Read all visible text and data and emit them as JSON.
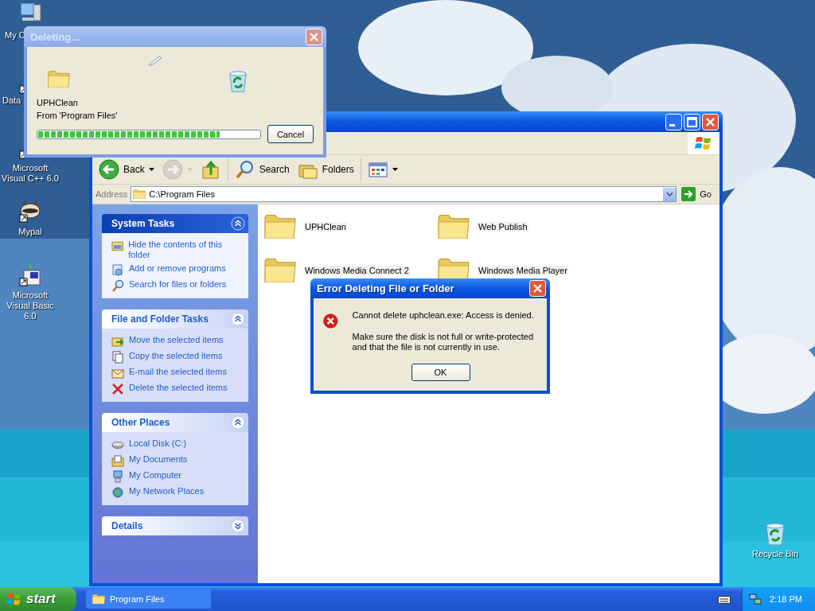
{
  "desktop_icons": [
    {
      "label": "My C",
      "kind": "computer"
    },
    {
      "label": "Data",
      "kind": "shortcut"
    },
    {
      "label": "Microsoft Visual C++ 6.0",
      "kind": "vc"
    },
    {
      "label": "Mypal",
      "kind": "raccoon"
    },
    {
      "label": "Microsoft Visual Basic 6.0",
      "kind": "vb"
    },
    {
      "label": "Recycle Bin",
      "kind": "bin"
    }
  ],
  "explorer": {
    "toolbar": [
      {
        "kind": "back",
        "label": "Back",
        "disabled": false
      },
      {
        "kind": "forward",
        "disabled": true
      },
      {
        "kind": "up",
        "disabled": false
      },
      {
        "kind": "search",
        "label": "Search",
        "disabled": false
      },
      {
        "kind": "folders",
        "label": "Folders",
        "disabled": false
      },
      {
        "kind": "views",
        "disabled": false
      }
    ],
    "address": {
      "label": "Address",
      "value": "C:\\Program Files",
      "go": "Go"
    },
    "panels": [
      {
        "title": "System Tasks",
        "highlighted": true,
        "expanded": true,
        "items": [
          {
            "kind": "hide",
            "label": "Hide the contents of this folder"
          },
          {
            "kind": "programs",
            "label": "Add or remove programs"
          },
          {
            "kind": "search",
            "label": "Search for files or folders"
          }
        ]
      },
      {
        "title": "File and Folder Tasks",
        "highlighted": false,
        "expanded": true,
        "items": [
          {
            "kind": "move",
            "label": "Move the selected items"
          },
          {
            "kind": "copy",
            "label": "Copy the selected items"
          },
          {
            "kind": "email",
            "label": "E-mail the selected items"
          },
          {
            "kind": "delete",
            "label": "Delete the selected items"
          }
        ]
      },
      {
        "title": "Other Places",
        "highlighted": false,
        "expanded": true,
        "items": [
          {
            "kind": "disk",
            "label": "Local Disk (C:)"
          },
          {
            "kind": "documents",
            "label": "My Documents"
          },
          {
            "kind": "computer",
            "label": "My Computer"
          },
          {
            "kind": "network",
            "label": "My Network Places"
          }
        ]
      },
      {
        "title": "Details",
        "highlighted": false,
        "expanded": false
      }
    ],
    "folders": [
      {
        "label": "UPHClean"
      },
      {
        "label": "Web Publish"
      },
      {
        "label": "Windows Media Connect 2"
      },
      {
        "label": "Windows Media Player"
      }
    ]
  },
  "progress_dialog": {
    "title": "Deleting...",
    "file": "UPHClean",
    "source": "From 'Program Files'",
    "level": 0.82,
    "button": "Cancel"
  },
  "error_dialog": {
    "title": "Error Deleting File or Folder",
    "message": "Cannot delete uphclean.exe: Access is denied.",
    "detail": "Make sure the disk is not full or write-protected and that the file is not currently in use.",
    "button": "OK"
  },
  "taskbar": {
    "start": "start",
    "tasks": [
      {
        "label": "Program Files",
        "selected": false
      }
    ],
    "clock": "2:18 PM"
  }
}
